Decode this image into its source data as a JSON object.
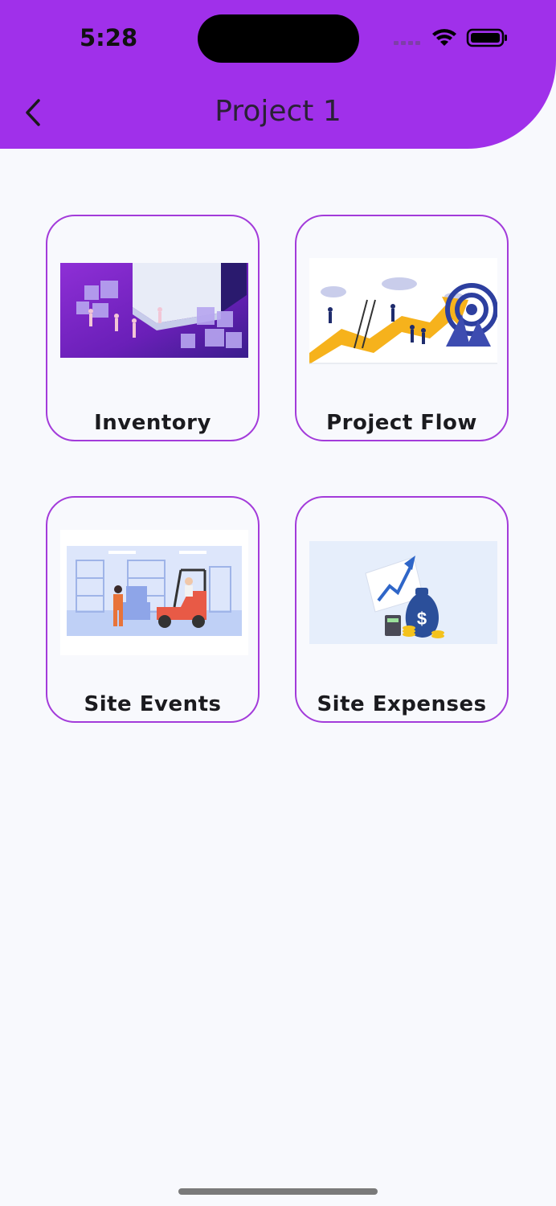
{
  "status_bar": {
    "time": "5:28"
  },
  "header": {
    "title": "Project 1",
    "back_icon": "chevron-left-icon",
    "background": "#A030EA"
  },
  "cards": [
    {
      "label": "Inventory",
      "illustration": "warehouse-boxes-illustration"
    },
    {
      "label": "Project Flow",
      "illustration": "target-growth-arrow-illustration"
    },
    {
      "label": "Site Events",
      "illustration": "forklift-warehouse-illustration"
    },
    {
      "label": "Site Expenses",
      "illustration": "money-bag-chart-illustration"
    }
  ],
  "colors": {
    "accent": "#A030EA",
    "card_border": "#A33BDA",
    "background": "#F8F9FD"
  }
}
